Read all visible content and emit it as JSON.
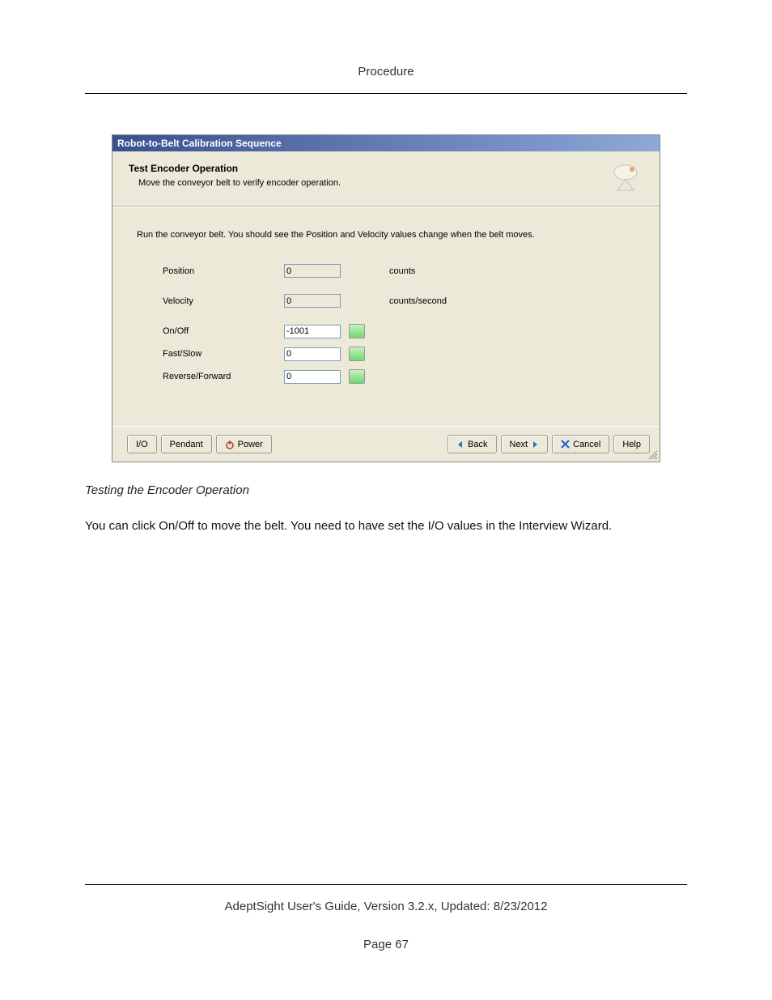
{
  "doc": {
    "header": "Procedure",
    "caption": "Testing the Encoder Operation",
    "paragraph": "You can click On/Off to move the belt. You need to have set the I/O values in the Interview Wizard.",
    "footer_line": "AdeptSight User's Guide,  Version 3.2.x, Updated: 8/23/2012",
    "page_number": "Page 67"
  },
  "dialog": {
    "title": "Robot-to-Belt Calibration Sequence",
    "heading": "Test Encoder Operation",
    "subheading": "Move the conveyor belt to verify encoder operation.",
    "instruction": "Run the conveyor belt.  You should see the Position and Velocity values change when the belt moves.",
    "fields": {
      "position": {
        "label": "Position",
        "value": "0",
        "units": "counts"
      },
      "velocity": {
        "label": "Velocity",
        "value": "0",
        "units": "counts/second"
      },
      "onoff": {
        "label": "On/Off",
        "value": "-1001"
      },
      "fastslow": {
        "label": "Fast/Slow",
        "value": "0"
      },
      "revfwd": {
        "label": "Reverse/Forward",
        "value": "0"
      }
    },
    "buttons": {
      "io": "I/O",
      "pendant": "Pendant",
      "power": "Power",
      "back": "Back",
      "next": "Next",
      "cancel": "Cancel",
      "help": "Help"
    }
  }
}
